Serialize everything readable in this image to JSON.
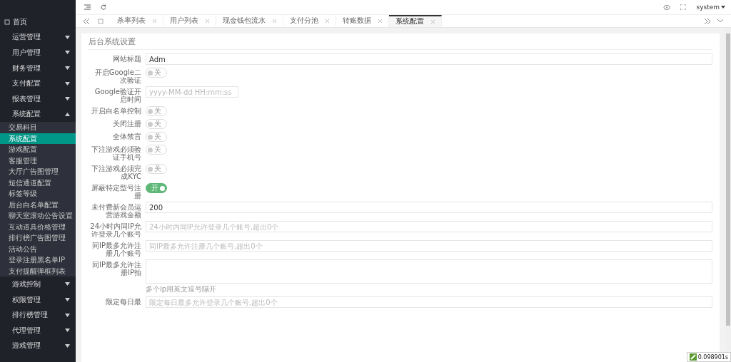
{
  "sidebar": {
    "items": [
      {
        "kind": "home",
        "label": "首页",
        "selected": false
      },
      {
        "kind": "group",
        "label": "运营管理",
        "expanded": false
      },
      {
        "kind": "group",
        "label": "用户管理",
        "expanded": false
      },
      {
        "kind": "group",
        "label": "财务管理",
        "expanded": false
      },
      {
        "kind": "group",
        "label": "支付配置",
        "expanded": false
      },
      {
        "kind": "group",
        "label": "报表管理",
        "expanded": false
      },
      {
        "kind": "group",
        "label": "系统配置",
        "expanded": true,
        "children": [
          {
            "label": "交易科目",
            "selected": false
          },
          {
            "label": "系统配置",
            "selected": true
          },
          {
            "label": "游戏配置",
            "selected": false
          },
          {
            "label": "客服管理",
            "selected": false
          },
          {
            "label": "大厅广告图管理",
            "selected": false
          },
          {
            "label": "短信通道配置",
            "selected": false
          },
          {
            "label": "标签等级",
            "selected": false
          },
          {
            "label": "后台白名单配置",
            "selected": false
          },
          {
            "label": "聊天室滚动公告设置",
            "selected": false
          },
          {
            "label": "互动道具价格管理",
            "selected": false
          },
          {
            "label": "排行榜广告图管理",
            "selected": false
          },
          {
            "label": "活动公告",
            "selected": false
          },
          {
            "label": "登录注册黑名单IP",
            "selected": false
          },
          {
            "label": "支付提醒弹框列表",
            "selected": false
          }
        ]
      },
      {
        "kind": "group",
        "label": "游戏控制",
        "expanded": false
      },
      {
        "kind": "group",
        "label": "权限管理",
        "expanded": false
      },
      {
        "kind": "group",
        "label": "排行榜管理",
        "expanded": false
      },
      {
        "kind": "group",
        "label": "代理管理",
        "expanded": false
      },
      {
        "kind": "group",
        "label": "游戏管理",
        "expanded": false
      }
    ]
  },
  "header": {
    "user": "system"
  },
  "tabs": [
    {
      "label": "杀率列表",
      "selected": false
    },
    {
      "label": "用户列表",
      "selected": false
    },
    {
      "label": "现金钱包流水",
      "selected": false
    },
    {
      "label": "支付分池",
      "selected": false
    },
    {
      "label": "转账数据",
      "selected": false
    },
    {
      "label": "系统配置",
      "selected": true
    }
  ],
  "form": {
    "title": "后台系统设置",
    "fields": [
      {
        "kind": "text",
        "label": "网站标题",
        "value": "Adm"
      },
      {
        "kind": "toggle",
        "label": "开启Google二次验证",
        "on": false,
        "text": "关"
      },
      {
        "kind": "date",
        "label": "Google验证开启时间",
        "placeholder": "yyyy-MM-dd HH:mm:ss"
      },
      {
        "kind": "toggle",
        "label": "开启白名单控制",
        "on": false,
        "text": "关"
      },
      {
        "kind": "toggle",
        "label": "关闭注册",
        "on": false,
        "text": "关"
      },
      {
        "kind": "toggle",
        "label": "全体禁言",
        "on": false,
        "text": "关"
      },
      {
        "kind": "toggle",
        "label": "下注游戏必须验证手机号",
        "on": false,
        "text": "关"
      },
      {
        "kind": "toggle",
        "label": "下注游戏必须完成KYC",
        "on": false,
        "text": "关"
      },
      {
        "kind": "toggle",
        "label": "屏蔽特定型号注册",
        "on": true,
        "text": "开"
      },
      {
        "kind": "text",
        "label": "未付费新会员运营游戏金额",
        "value": "200"
      },
      {
        "kind": "text",
        "label": "24小时内同IP允许登录几个账号",
        "placeholder": "24小时内同IP允许登录几个账号,超出0个"
      },
      {
        "kind": "text",
        "label": "同IP最多允许注册几个账号",
        "placeholder": "同IP最多允许注册几个账号,超出0个"
      },
      {
        "kind": "textarea",
        "label": "同IP最多允许注册IP拍",
        "help": "多个ip用英文逗号隔开"
      },
      {
        "kind": "text",
        "label": "限定每日最",
        "placeholder": "限定每日最多允许登录几个账号,超出0个"
      }
    ]
  },
  "timer": "0.098901s"
}
